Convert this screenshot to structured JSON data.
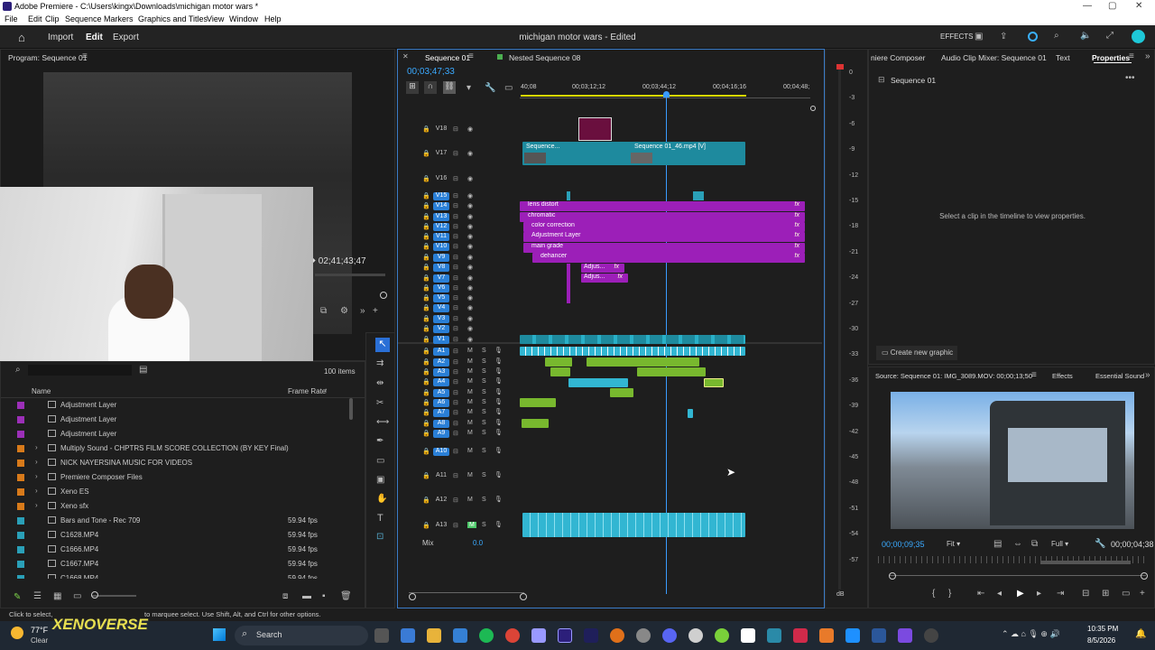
{
  "titlebar": {
    "title": "Adobe Premiere - C:\\Users\\kingx\\Downloads\\michigan motor wars *",
    "minimize": "—",
    "maximize": "▢",
    "close": "✕"
  },
  "menu": [
    "File",
    "Edit",
    "Clip",
    "Sequence",
    "Markers",
    "Graphics and Titles",
    "View",
    "Window",
    "Help"
  ],
  "header": {
    "import": "Import",
    "edit": "Edit",
    "export": "Export",
    "project": "michigan motor wars",
    "status": "- Edited",
    "effects": "EFFECTS"
  },
  "program": {
    "title": "Program: Sequence 01",
    "timecode": "02;41;43;47"
  },
  "project": {
    "items_count": "100 items",
    "col_name": "Name",
    "col_framerate": "Frame Rate",
    "rows": [
      {
        "name": "Adjustment Layer",
        "rate": "",
        "color": "#9c2fb8",
        "type": "item"
      },
      {
        "name": "Adjustment Layer",
        "rate": "",
        "color": "#9c2fb8",
        "type": "item"
      },
      {
        "name": "Adjustment Layer",
        "rate": "",
        "color": "#9c2fb8",
        "type": "item"
      },
      {
        "name": "Multiply Sound - CHPTRS FILM SCORE COLLECTION (BY KEY Final)",
        "rate": "",
        "color": "#d87a1a",
        "type": "folder"
      },
      {
        "name": "NICK NAYERSINA MUSIC FOR VIDEOS",
        "rate": "",
        "color": "#d87a1a",
        "type": "folder"
      },
      {
        "name": "Premiere Composer Files",
        "rate": "",
        "color": "#d87a1a",
        "type": "folder"
      },
      {
        "name": "Xeno ES",
        "rate": "",
        "color": "#d87a1a",
        "type": "folder"
      },
      {
        "name": "Xeno sfx",
        "rate": "",
        "color": "#d87a1a",
        "type": "folder"
      },
      {
        "name": "Bars and Tone - Rec 709",
        "rate": "59.94 fps",
        "color": "#2aa0b8",
        "type": "item"
      },
      {
        "name": "C1628.MP4",
        "rate": "59.94 fps",
        "color": "#2aa0b8",
        "type": "item"
      },
      {
        "name": "C1666.MP4",
        "rate": "59.94 fps",
        "color": "#2aa0b8",
        "type": "item"
      },
      {
        "name": "C1667.MP4",
        "rate": "59.94 fps",
        "color": "#2aa0b8",
        "type": "item"
      },
      {
        "name": "C1668.MP4",
        "rate": "59.94 fps",
        "color": "#2aa0b8",
        "type": "item"
      }
    ]
  },
  "timeline": {
    "tab1": "Sequence 01",
    "tab2": "Nested Sequence 08",
    "timecode": "00;03;47;33",
    "ruler": [
      "40;08",
      "00;03;12;12",
      "00;03;44;12",
      "00;04;16;16",
      "00;04;48;"
    ],
    "mix_label": "Mix",
    "mix_value": "0.0",
    "video_tracks": [
      "V18",
      "V17",
      "V16",
      "V15",
      "V14",
      "V13",
      "V12",
      "V11",
      "V10",
      "V9",
      "V8",
      "V7",
      "V6",
      "V5",
      "V4",
      "V3",
      "V2",
      "V1"
    ],
    "audio_tracks": [
      "A1",
      "A2",
      "A3",
      "A4",
      "A5",
      "A6",
      "A7",
      "A8",
      "A9",
      "A10",
      "A11",
      "A12",
      "A13"
    ],
    "adj_clips": [
      "lens distort",
      "chromatic",
      "color correction",
      "Adjustment Layer",
      "main grade",
      "dehancer"
    ],
    "small_clips": [
      "Adjus...",
      "Adjus..."
    ],
    "v17_clips": [
      "Sequence...",
      "Sequence 01_46.mp4 [V]"
    ]
  },
  "meter": {
    "labels": [
      "0",
      "-3",
      "-6",
      "-9",
      "-12",
      "-15",
      "-18",
      "-21",
      "-24",
      "-27",
      "-30",
      "-33",
      "-36",
      "-39",
      "-42",
      "-45",
      "-48",
      "-51",
      "-54",
      "-57"
    ],
    "bottom": "dB"
  },
  "right_tabs": [
    "niere Composer",
    "Audio Clip Mixer: Sequence 01",
    "Text",
    "Properties"
  ],
  "properties": {
    "sequence": "Sequence 01",
    "hint": "Select a clip in the timeline to view properties.",
    "new_graphic": "Create new graphic"
  },
  "source": {
    "title": "Source: Sequence 01: IMG_3089.MOV: 00;00;13;50",
    "tab_effects": "Effects",
    "tab_sound": "Essential Sound",
    "timecode": "00;00;09;35",
    "fit": "Fit",
    "quality": "Full",
    "right_tc": "00;00;04;38"
  },
  "status_text": "Click to select, or click in empty space and drag to marquee select. Use Shift, Alt, and Ctrl for other options.",
  "status_visible": "Click to select,",
  "status_visible2": "to marquee select. Use Shift, Alt, and Ctrl for other options.",
  "taskbar": {
    "temp": "77°F",
    "weather": "Clear",
    "search": "Search",
    "time": "10:35 PM",
    "date": "8/5/2026",
    "watermark": "XENOVERSE"
  }
}
